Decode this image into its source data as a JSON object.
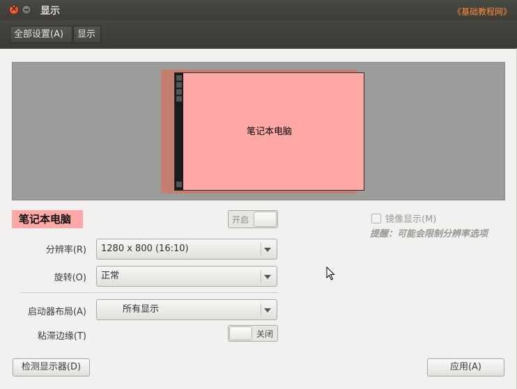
{
  "window": {
    "title": "显示",
    "watermark": "《基础教程网》"
  },
  "toolbar": {
    "crumbs": [
      "全部设置(A)",
      "显示"
    ]
  },
  "preview": {
    "monitor_label": "笔记本电脑"
  },
  "monitor": {
    "name": "笔记本电脑",
    "power_toggle_label": "开启",
    "power_on": true
  },
  "mirror": {
    "label": "镜像显示(M)",
    "checked": false,
    "hint": "提醒：可能会限制分辨率选项"
  },
  "settings": {
    "resolution_label": "分辨率(R)",
    "resolution_value": "1280 x 800 (16:10)",
    "rotation_label": "旋转(O)",
    "rotation_value": "正常",
    "launcher_label": "启动器布局(A)",
    "launcher_value": "所有显示",
    "sticky_label": "粘滞边缘(T)",
    "sticky_toggle_label": "关闭",
    "sticky_on": false
  },
  "buttons": {
    "detect": "检测显示器(D)",
    "apply": "应用(A)"
  }
}
